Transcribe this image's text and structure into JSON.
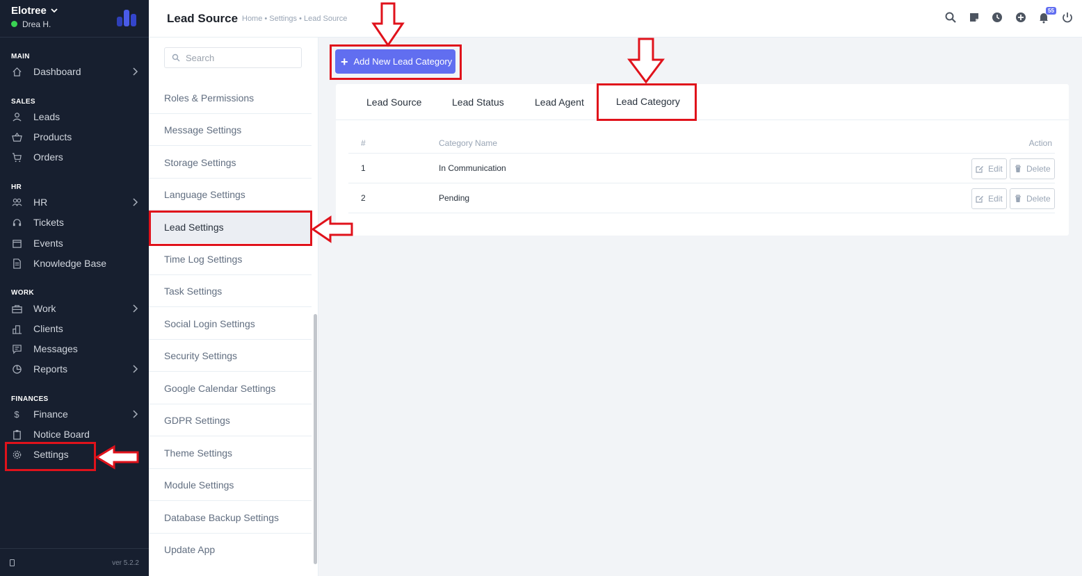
{
  "sidebar": {
    "company": "Elotree",
    "user": "Drea H.",
    "sections": {
      "main": "MAIN",
      "sales": "SALES",
      "hr": "HR",
      "work": "WORK",
      "finances": "FINANCES"
    },
    "items": {
      "dashboard": "Dashboard",
      "leads": "Leads",
      "products": "Products",
      "orders": "Orders",
      "hr": "HR",
      "tickets": "Tickets",
      "events": "Events",
      "knowledge_base": "Knowledge Base",
      "work": "Work",
      "clients": "Clients",
      "messages": "Messages",
      "reports": "Reports",
      "finance": "Finance",
      "finance_symbol": "$",
      "notice_board": "Notice Board",
      "settings": "Settings"
    },
    "version": "ver 5.2.2"
  },
  "header": {
    "title": "Lead Source",
    "breadcrumb": "Home • Settings • Lead Source",
    "notification_count": "55"
  },
  "settings_menu": {
    "search_placeholder": "Search",
    "items": [
      "Roles & Permissions",
      "Message Settings",
      "Storage Settings",
      "Language Settings",
      "Lead Settings",
      "Time Log Settings",
      "Task Settings",
      "Social Login Settings",
      "Security Settings",
      "Google Calendar Settings",
      "GDPR Settings",
      "Theme Settings",
      "Module Settings",
      "Database Backup Settings",
      "Update App"
    ],
    "active": "Lead Settings"
  },
  "content": {
    "add_button": "Add New Lead Category",
    "tabs": [
      "Lead Source",
      "Lead Status",
      "Lead Agent",
      "Lead Category"
    ],
    "active_tab": "Lead Category",
    "table": {
      "headers": [
        "#",
        "Category Name",
        "Action"
      ],
      "rows": [
        {
          "num": "1",
          "name": "In Communication"
        },
        {
          "num": "2",
          "name": "Pending"
        }
      ],
      "edit_label": "Edit",
      "delete_label": "Delete"
    }
  },
  "colors": {
    "sidebar_bg": "#171f2f",
    "accent": "#616ef0",
    "annotation_red": "#e0121b"
  }
}
